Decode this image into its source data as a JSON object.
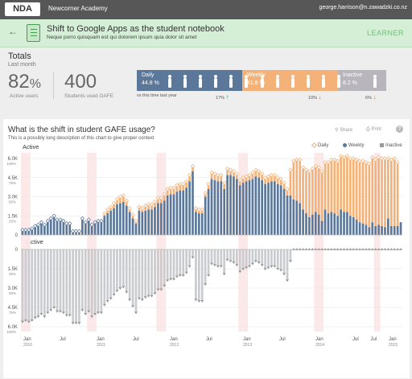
{
  "header": {
    "logo": "NDA",
    "org": "Newcorner Academy",
    "email": "george.harrison@n.zawadzki.co.nz"
  },
  "activity": {
    "back_icon": "arrow-left-icon",
    "title": "Shift to Google Apps as the student notebook",
    "subtitle": "Neque porro quisquam est qui dolorem ipsum quia dolor sit amet",
    "role": "LEARNER"
  },
  "totals": {
    "title": "Totals",
    "period": "Last month",
    "active_value": "82",
    "active_unit": "%",
    "active_label": "Active users",
    "students_value": "400",
    "students_label": "Students used GAFE",
    "vs_label": "vs this time last year",
    "segments": [
      {
        "name": "Daily",
        "pct": "44.8 %",
        "change": "17%",
        "direction": "up",
        "color": "#5b7799",
        "people": 6
      },
      {
        "name": "Weekly",
        "pct": "41.8 %",
        "change": "10%",
        "direction": "down",
        "color": "#f4b278",
        "people": 6
      },
      {
        "name": "Inactive",
        "pct": "8.2 %",
        "change": "6%",
        "direction": "down",
        "color": "#b9b5bd",
        "people": 1
      }
    ]
  },
  "chart": {
    "title": "What is the shift in student GAFE usage?",
    "subtitle": "This is a possibly long description of this chart to give proper context",
    "share_label": "Share",
    "print_label": "Print",
    "help_label": "?",
    "active_label": "Active",
    "inactive_label": "Inactive",
    "legend": [
      {
        "label": "Daily",
        "color": "#f4b278"
      },
      {
        "label": "Weekly",
        "color": "#5b7799"
      },
      {
        "label": "Inactive",
        "color": "#9a9a9a"
      }
    ]
  },
  "chart_data": {
    "type": "bar",
    "x_labels": [
      "Jan",
      "Jul",
      "Jan",
      "Jul",
      "Jan",
      "Jul",
      "Jan",
      "Jul",
      "Jan",
      "Jul",
      "Jan",
      "Jul"
    ],
    "x_years": [
      "2010",
      "",
      "2011",
      "",
      "2012",
      "",
      "2013",
      "",
      "2014",
      "",
      "2015",
      ""
    ],
    "active_axis": {
      "ticks": [
        "6.0K",
        "4.5K",
        "3.0K",
        "1.5K",
        "0"
      ],
      "pct_ticks": [
        "100%",
        "75%",
        "50%",
        "25%"
      ],
      "max": 6000
    },
    "inactive_axis": {
      "ticks": [
        "0",
        "1.5K",
        "3.0K",
        "4.5K",
        "6.0K"
      ],
      "pct_ticks": [
        "25%",
        "50%",
        "75%",
        "100%"
      ],
      "max": 6000
    },
    "highlight_weeks": [
      0,
      1,
      2,
      21,
      22,
      23,
      43,
      44,
      45,
      69,
      70,
      71,
      93,
      94,
      95,
      112,
      113
    ],
    "series": [
      {
        "name": "Weekly",
        "values": [
          400,
          400,
          400,
          500,
          700,
          800,
          1000,
          800,
          1100,
          1300,
          1500,
          1200,
          1200,
          1100,
          900,
          900,
          300,
          300,
          300,
          1300,
          1000,
          1200,
          800,
          1000,
          1100,
          1100,
          1500,
          1700,
          1900,
          2100,
          2400,
          2500,
          2600,
          2300,
          1800,
          1300,
          900,
          1900,
          1800,
          1900,
          2000,
          2000,
          2200,
          2500,
          2500,
          2700,
          3100,
          3200,
          3200,
          3400,
          3500,
          3500,
          3700,
          4200,
          5000,
          1800,
          1700,
          1700,
          3000,
          3600,
          4400,
          4300,
          4200,
          4200,
          3600,
          4700,
          4700,
          4600,
          4400,
          3900,
          4100,
          4200,
          4300,
          4400,
          4600,
          4500,
          4300,
          4000,
          4100,
          4200,
          4200,
          4000,
          3900,
          3600,
          3100,
          3100,
          2800,
          2700,
          2500,
          2000,
          1700,
          1400,
          1600,
          1800,
          1600,
          1100,
          2000,
          1700,
          1800,
          1700,
          1500,
          2000,
          1800,
          1800,
          1500,
          1400,
          1200,
          1000,
          900,
          800,
          600,
          1000,
          700,
          800,
          700,
          600,
          1300,
          700,
          700,
          700,
          1000
        ]
      },
      {
        "name": "Daily",
        "values": [
          0,
          0,
          0,
          0,
          0,
          0,
          0,
          0,
          0,
          0,
          0,
          0,
          0,
          0,
          0,
          0,
          0,
          0,
          0,
          0,
          0,
          0,
          0,
          0,
          0,
          0,
          200,
          300,
          300,
          400,
          400,
          500,
          500,
          400,
          300,
          300,
          200,
          300,
          300,
          400,
          400,
          400,
          400,
          400,
          400,
          500,
          500,
          500,
          500,
          500,
          500,
          500,
          500,
          500,
          400,
          300,
          300,
          300,
          300,
          400,
          500,
          500,
          500,
          500,
          500,
          500,
          400,
          400,
          400,
          400,
          400,
          400,
          400,
          500,
          500,
          500,
          500,
          500,
          500,
          500,
          500,
          500,
          500,
          500,
          500,
          2000,
          3000,
          3200,
          3400,
          3300,
          3400,
          3600,
          3600,
          3600,
          3700,
          3900,
          3700,
          4000,
          4100,
          4200,
          4300,
          4200,
          4300,
          4400,
          4500,
          4600,
          4700,
          4800,
          4900,
          4900,
          5000,
          5100,
          5200,
          5300,
          5300,
          5400,
          4700,
          5200,
          5300,
          5000
        ]
      },
      {
        "name": "Inactive",
        "values": [
          5600,
          5500,
          5600,
          5500,
          5300,
          5200,
          5000,
          5200,
          4900,
          4700,
          4500,
          4800,
          4800,
          4900,
          5100,
          5100,
          5700,
          5700,
          5700,
          4700,
          5000,
          4800,
          5200,
          5000,
          4900,
          4900,
          4300,
          4000,
          3800,
          3500,
          3200,
          3000,
          2900,
          3300,
          3900,
          4400,
          4900,
          3800,
          3900,
          3700,
          3600,
          3600,
          3400,
          3100,
          3100,
          2800,
          2400,
          2300,
          2300,
          2100,
          2000,
          2000,
          1800,
          1300,
          600,
          3900,
          4000,
          4000,
          2700,
          2000,
          1100,
          1200,
          1300,
          1300,
          1900,
          800,
          900,
          1000,
          1200,
          1700,
          1500,
          1400,
          1300,
          1100,
          900,
          1000,
          1200,
          1500,
          1400,
          1300,
          1300,
          1500,
          1600,
          1900,
          2400,
          900,
          0,
          0,
          0,
          0,
          0,
          0,
          0,
          0,
          0,
          0,
          0,
          0,
          0,
          0,
          0,
          0,
          0,
          0,
          0,
          0,
          0,
          0,
          0,
          0,
          0,
          0,
          0,
          0,
          0,
          0,
          0,
          0,
          0,
          0
        ]
      }
    ]
  }
}
